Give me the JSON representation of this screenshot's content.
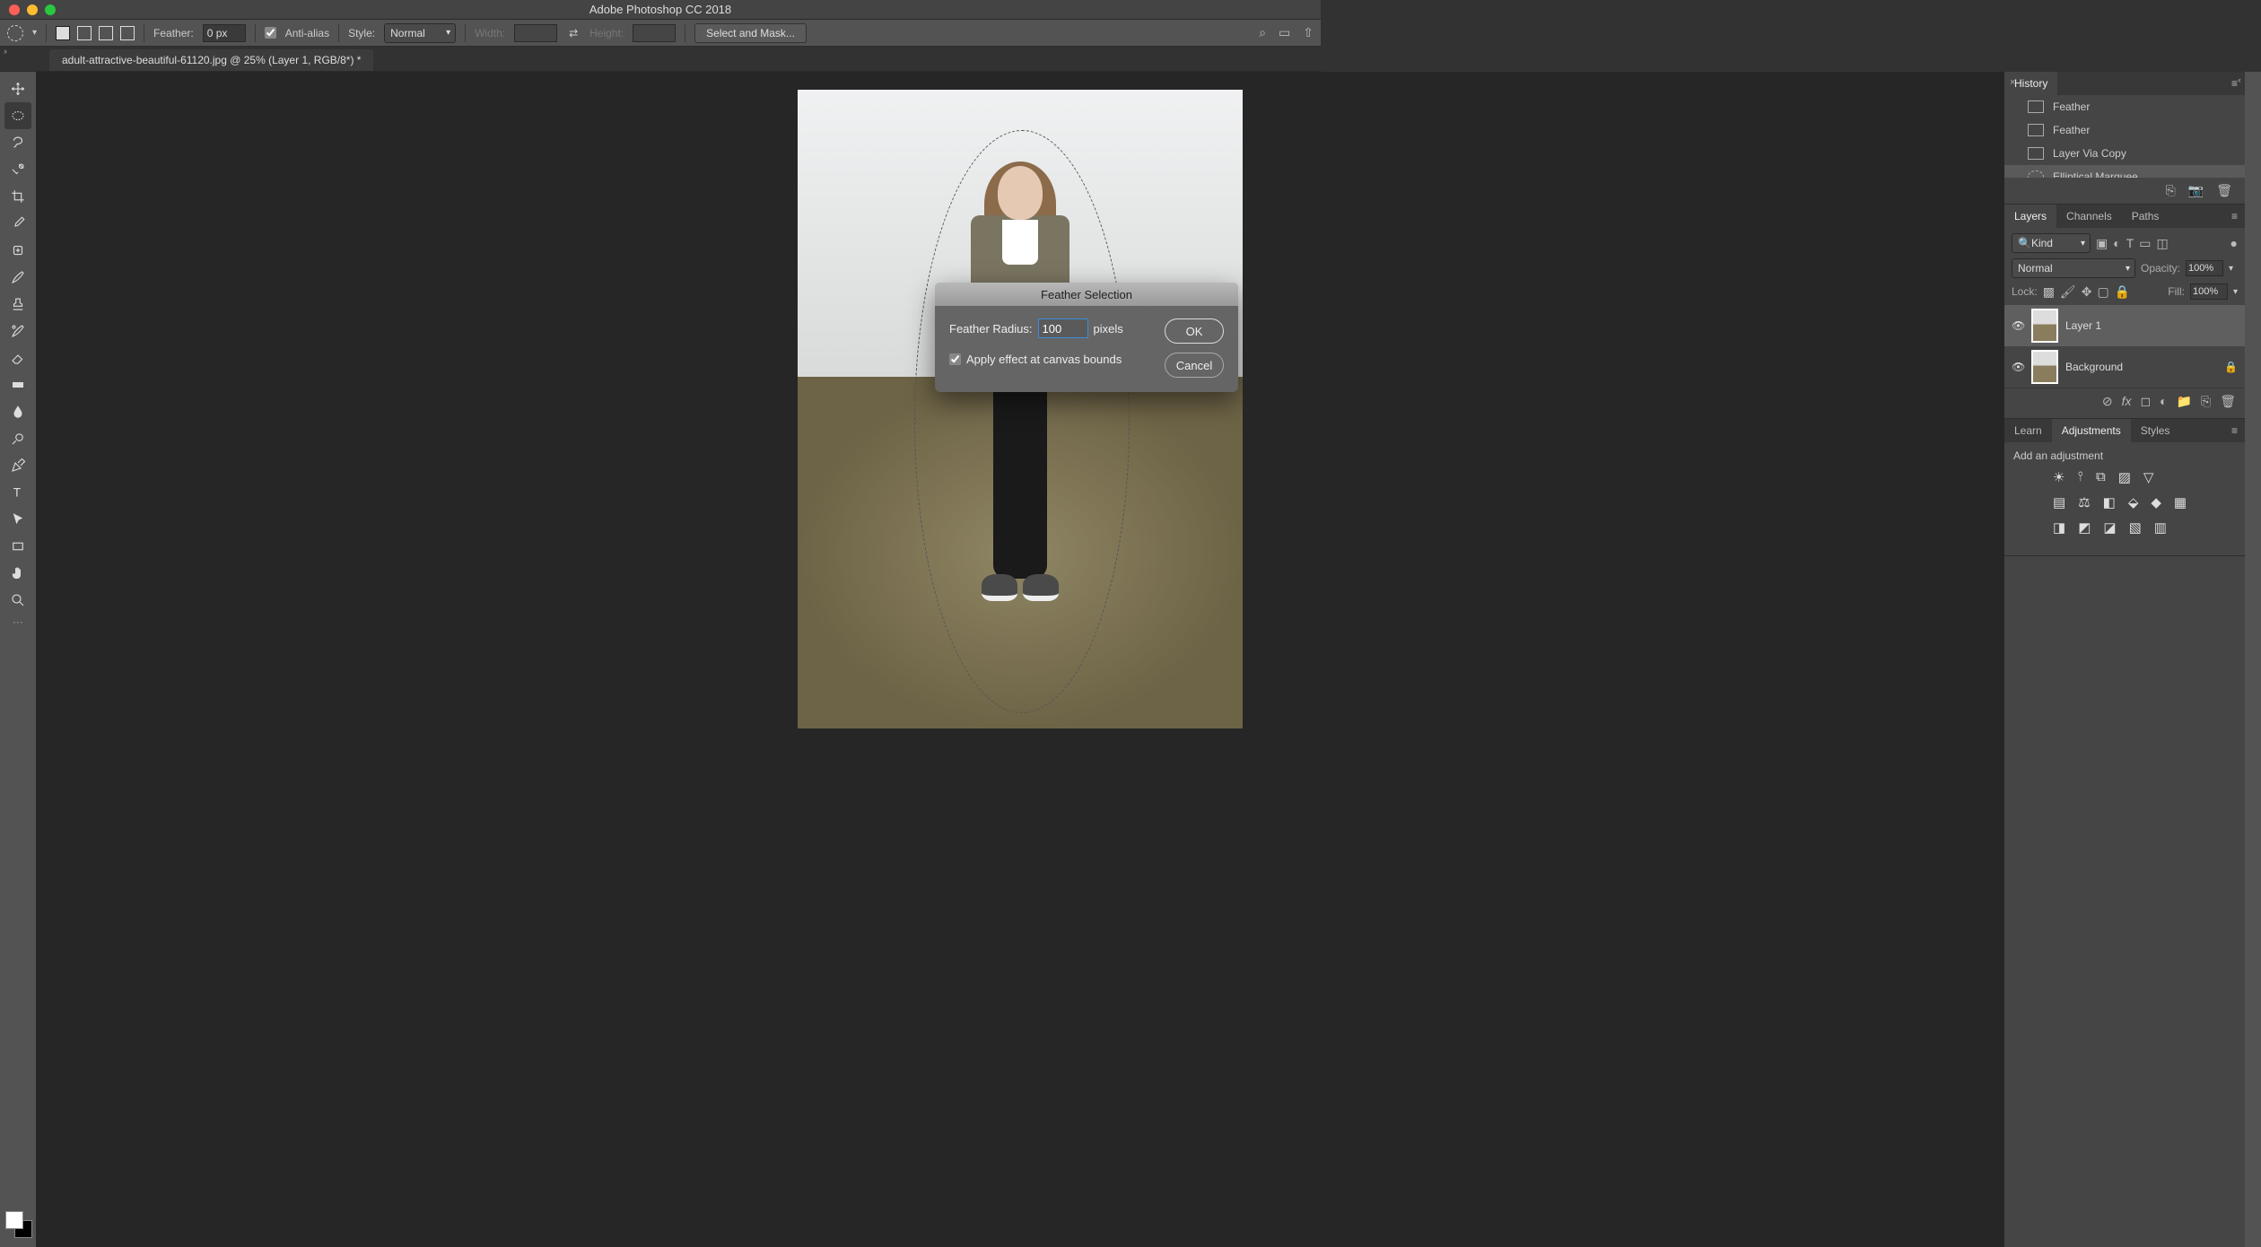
{
  "titlebar": {
    "title": "Adobe Photoshop CC 2018"
  },
  "options": {
    "feather_label": "Feather:",
    "feather_value": "0 px",
    "anti_alias": "Anti-alias",
    "style_label": "Style:",
    "style_value": "Normal",
    "width_label": "Width:",
    "height_label": "Height:",
    "mask_button": "Select and Mask..."
  },
  "doc_tab": "adult-attractive-beautiful-61120.jpg @ 25% (Layer 1, RGB/8*) *",
  "dialog": {
    "title": "Feather Selection",
    "radius_label": "Feather Radius:",
    "radius_value": "100",
    "radius_unit": "pixels",
    "canvas_bounds": "Apply effect at canvas bounds",
    "ok": "OK",
    "cancel": "Cancel"
  },
  "history": {
    "tab": "History",
    "items": [
      "Feather",
      "Feather",
      "Layer Via Copy",
      "Elliptical Marquee"
    ]
  },
  "layers": {
    "tabs": [
      "Layers",
      "Channels",
      "Paths"
    ],
    "kind": "Kind",
    "blend": "Normal",
    "opacity_label": "Opacity:",
    "opacity_value": "100%",
    "lock_label": "Lock:",
    "fill_label": "Fill:",
    "fill_value": "100%",
    "items": [
      {
        "name": "Layer 1",
        "locked": false,
        "selected": true
      },
      {
        "name": "Background",
        "locked": true,
        "selected": false
      }
    ]
  },
  "bottom_tabs": [
    "Learn",
    "Adjustments",
    "Styles"
  ],
  "adjustments": {
    "title": "Add an adjustment"
  }
}
